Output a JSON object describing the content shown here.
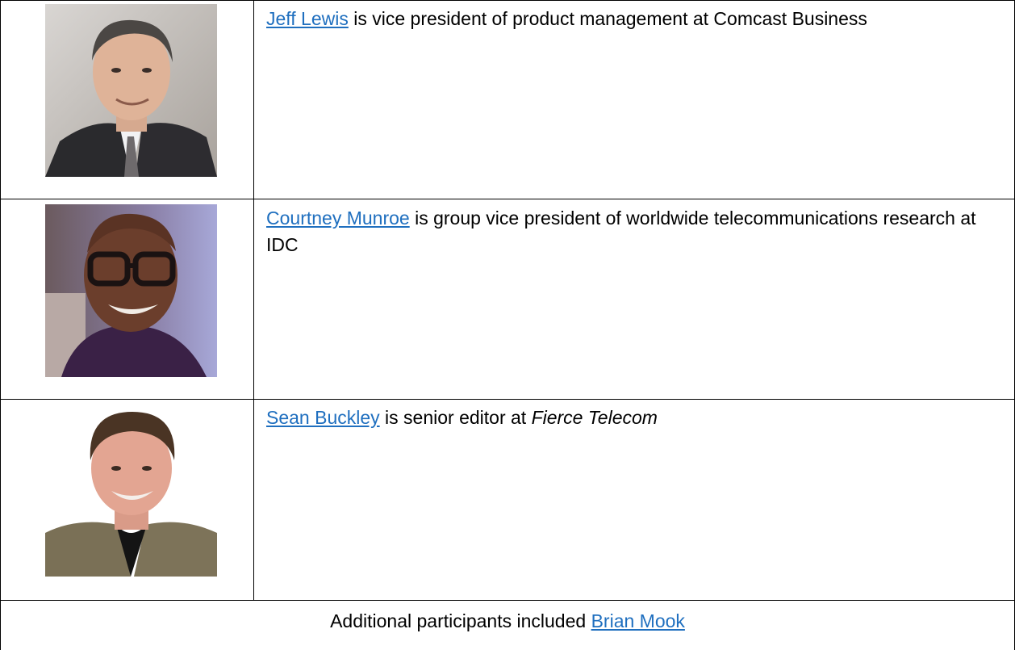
{
  "rows": [
    {
      "link_text": "Jeff Lewis",
      "description": " is vice president of product management at Comcast Business",
      "photo_icon": "portrait-photo"
    },
    {
      "link_text": "Courtney Munroe",
      "description": " is group vice president of worldwide telecommunications research at IDC",
      "photo_icon": "portrait-photo"
    },
    {
      "link_text": "Sean Buckley",
      "description": " is senior editor at ",
      "publication": "Fierce Telecom",
      "photo_icon": "portrait-photo"
    }
  ],
  "footer": {
    "text": "Additional participants included ",
    "link_text": "Brian Mook"
  },
  "colors": {
    "link": "#1f6fbf",
    "border": "#000000"
  }
}
